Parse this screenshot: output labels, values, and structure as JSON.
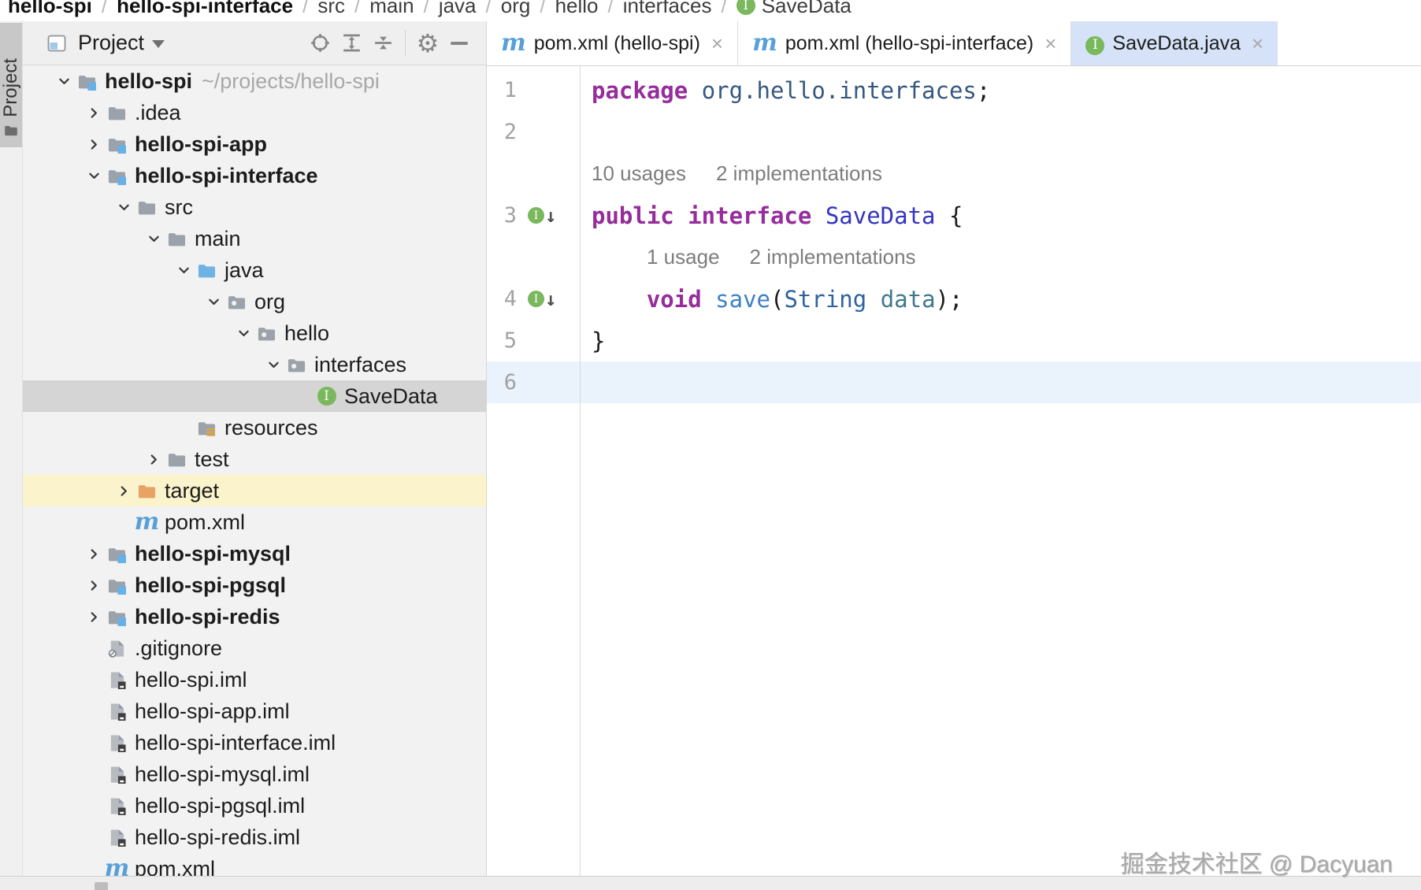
{
  "breadcrumb": {
    "items": [
      {
        "label": "hello-spi",
        "bold": true
      },
      {
        "label": "hello-spi-interface",
        "bold": true
      },
      {
        "label": "src"
      },
      {
        "label": "main"
      },
      {
        "label": "java"
      },
      {
        "label": "org"
      },
      {
        "label": "hello"
      },
      {
        "label": "interfaces"
      },
      {
        "label": "SaveData",
        "icon": "interface"
      }
    ]
  },
  "tool_stripe": {
    "project_label": "Project"
  },
  "project_panel": {
    "title": "Project"
  },
  "tree": {
    "items": [
      {
        "level": 0,
        "chevron": "down",
        "icon": "module-folder",
        "label": "hello-spi",
        "bold": true,
        "annotation": "~/projects/hello-spi"
      },
      {
        "level": 1,
        "chevron": "right",
        "icon": "folder",
        "label": ".idea"
      },
      {
        "level": 1,
        "chevron": "right",
        "icon": "module-folder",
        "label": "hello-spi-app",
        "bold": true
      },
      {
        "level": 1,
        "chevron": "down",
        "icon": "module-folder",
        "label": "hello-spi-interface",
        "bold": true
      },
      {
        "level": 2,
        "chevron": "down",
        "icon": "folder",
        "label": "src"
      },
      {
        "level": 3,
        "chevron": "down",
        "icon": "folder",
        "label": "main"
      },
      {
        "level": 4,
        "chevron": "down",
        "icon": "source-folder",
        "label": "java"
      },
      {
        "level": 5,
        "chevron": "down",
        "icon": "package-folder",
        "label": "org"
      },
      {
        "level": 6,
        "chevron": "down",
        "icon": "package-folder",
        "label": "hello"
      },
      {
        "level": 7,
        "chevron": "down",
        "icon": "package-folder",
        "label": "interfaces"
      },
      {
        "level": 8,
        "chevron": null,
        "icon": "interface",
        "label": "SaveData",
        "state": "selected"
      },
      {
        "level": 4,
        "chevron": null,
        "icon": "resources-folder",
        "label": "resources"
      },
      {
        "level": 3,
        "chevron": "right",
        "icon": "folder",
        "label": "test"
      },
      {
        "level": 2,
        "chevron": "right",
        "icon": "excluded-folder",
        "label": "target",
        "state": "target"
      },
      {
        "level": 2,
        "chevron": null,
        "icon": "maven",
        "label": "pom.xml"
      },
      {
        "level": 1,
        "chevron": "right",
        "icon": "module-folder",
        "label": "hello-spi-mysql",
        "bold": true
      },
      {
        "level": 1,
        "chevron": "right",
        "icon": "module-folder",
        "label": "hello-spi-pgsql",
        "bold": true
      },
      {
        "level": 1,
        "chevron": "right",
        "icon": "module-folder",
        "label": "hello-spi-redis",
        "bold": true
      },
      {
        "level": 1,
        "chevron": null,
        "icon": "ignore-file",
        "label": ".gitignore"
      },
      {
        "level": 1,
        "chevron": null,
        "icon": "iml-file",
        "label": "hello-spi.iml"
      },
      {
        "level": 1,
        "chevron": null,
        "icon": "iml-file",
        "label": "hello-spi-app.iml"
      },
      {
        "level": 1,
        "chevron": null,
        "icon": "iml-file",
        "label": "hello-spi-interface.iml"
      },
      {
        "level": 1,
        "chevron": null,
        "icon": "iml-file",
        "label": "hello-spi-mysql.iml"
      },
      {
        "level": 1,
        "chevron": null,
        "icon": "iml-file",
        "label": "hello-spi-pgsql.iml"
      },
      {
        "level": 1,
        "chevron": null,
        "icon": "iml-file",
        "label": "hello-spi-redis.iml"
      },
      {
        "level": 1,
        "chevron": null,
        "icon": "maven",
        "label": "pom.xml"
      }
    ]
  },
  "tabs": {
    "items": [
      {
        "icon": "maven",
        "label": "pom.xml (hello-spi)",
        "close": "×",
        "active": false
      },
      {
        "icon": "maven",
        "label": "pom.xml (hello-spi-interface)",
        "close": "×",
        "active": false
      },
      {
        "icon": "interface",
        "label": "SaveData.java",
        "close": "×",
        "active": true
      }
    ]
  },
  "editor": {
    "rows": [
      {
        "type": "code",
        "num": "1",
        "tokens": [
          {
            "t": "package ",
            "c": "keyword"
          },
          {
            "t": "org.hello.interfaces",
            "c": "pkg"
          },
          {
            "t": ";",
            "c": "plain"
          }
        ]
      },
      {
        "type": "code",
        "num": "2",
        "tokens": []
      },
      {
        "type": "inlay",
        "parts": [
          "10 usages",
          "2 implementations"
        ],
        "indent": 0
      },
      {
        "type": "code",
        "num": "3",
        "gutter": "implemented",
        "tokens": [
          {
            "t": "public interface ",
            "c": "keyword"
          },
          {
            "t": "SaveData ",
            "c": "class"
          },
          {
            "t": "{",
            "c": "plain"
          }
        ]
      },
      {
        "type": "inlay",
        "parts": [
          "1 usage",
          "2 implementations"
        ],
        "indent": 70
      },
      {
        "type": "code",
        "num": "4",
        "gutter": "implemented",
        "tokens": [
          {
            "t": "    ",
            "c": "plain"
          },
          {
            "t": "void ",
            "c": "keyword"
          },
          {
            "t": "save",
            "c": "method"
          },
          {
            "t": "(",
            "c": "plain"
          },
          {
            "t": "String ",
            "c": "type"
          },
          {
            "t": "data",
            "c": "param"
          },
          {
            "t": ");",
            "c": "plain"
          }
        ]
      },
      {
        "type": "code",
        "num": "5",
        "tokens": [
          {
            "t": "}",
            "c": "plain"
          }
        ]
      },
      {
        "type": "code",
        "num": "6",
        "caret_line": true,
        "tokens": []
      }
    ]
  },
  "watermark": {
    "text": "掘金技术社区 @ Dacyuan"
  },
  "colors": {
    "keyword": "#952d9b",
    "package_ref": "#36587f",
    "class_name": "#3434c0",
    "method_name": "#3e80c4",
    "type_name": "#2f639e",
    "param_name": "#3f788c",
    "inlay_gray": "#7d7d7d",
    "active_tab_bg": "#d5e2f7",
    "selected_row": "#d5d5d5",
    "target_row_bg": "#faf3cb",
    "caret_line_bg": "#eaf3fc",
    "interface_green": "#79b85c",
    "maven_blue": "#5aa0d8",
    "source_root_blue": "#6fb2e6",
    "excluded_orange": "#e9a265"
  }
}
